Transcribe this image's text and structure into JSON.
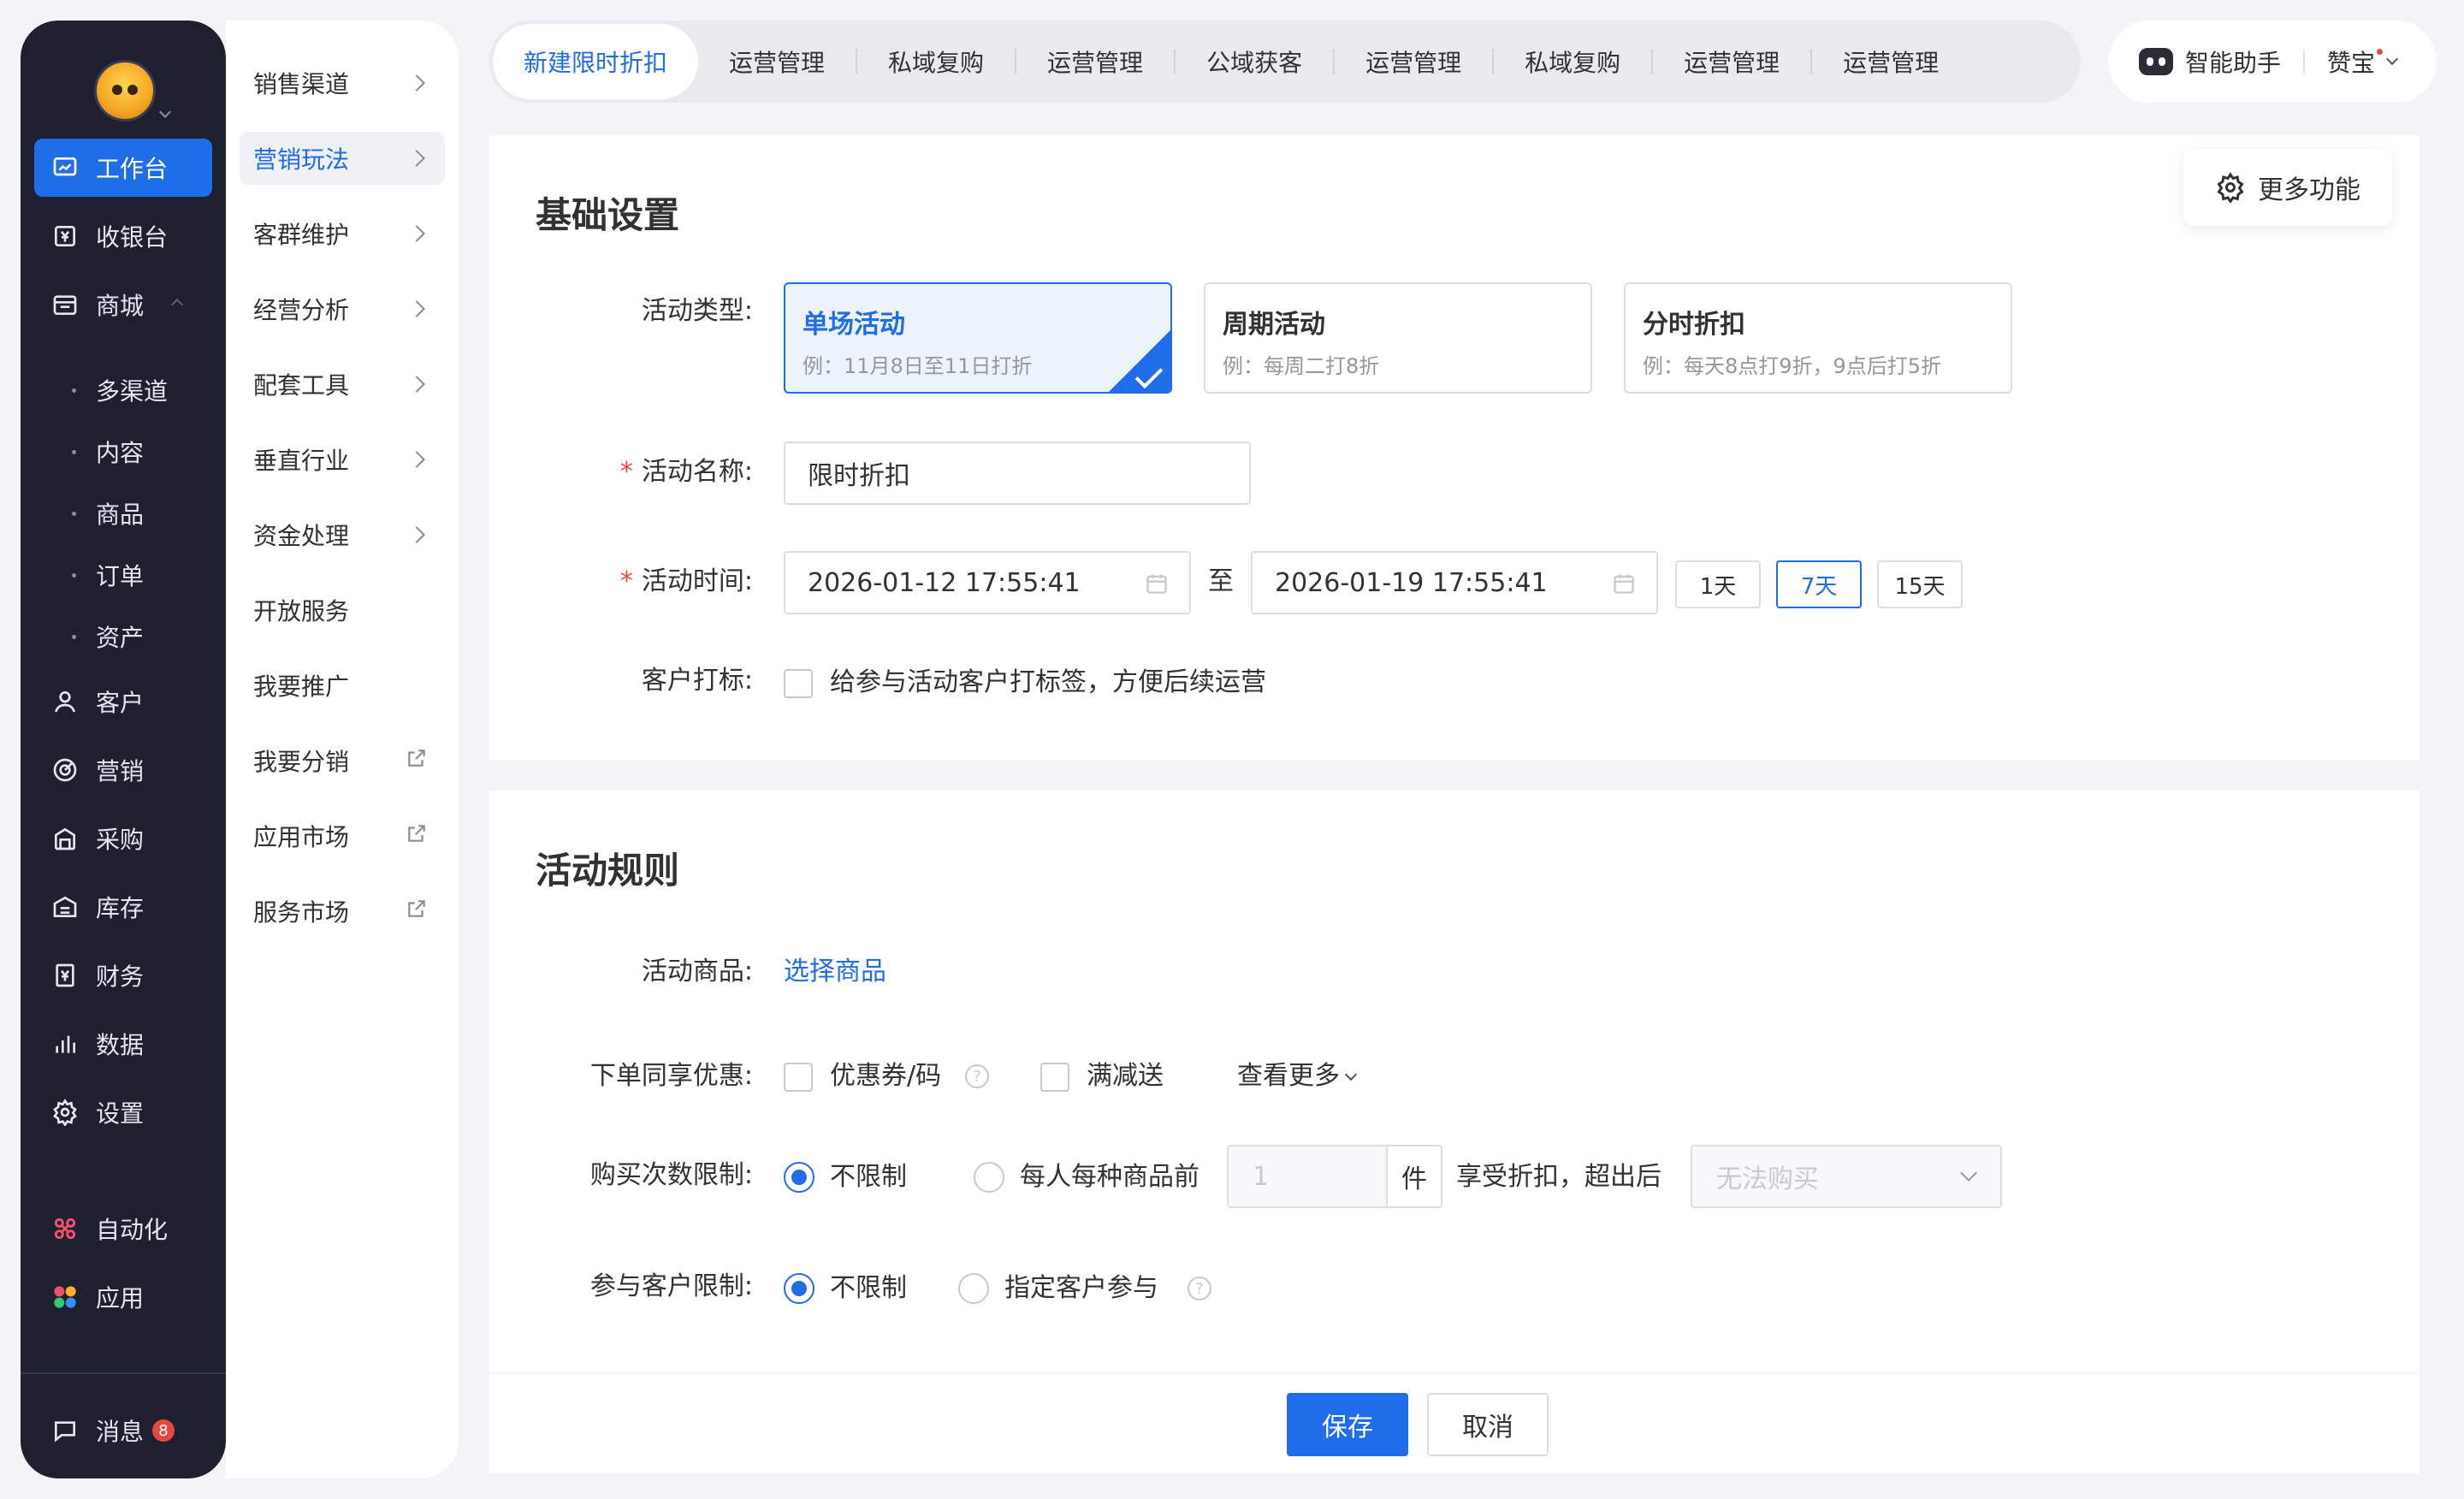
{
  "primary_nav": {
    "items": [
      {
        "label": "工作台",
        "icon": "workbench-icon",
        "active": true
      },
      {
        "label": "收银台",
        "icon": "cashier-icon"
      },
      {
        "label": "商城",
        "icon": "store-icon"
      },
      {
        "label": "客户",
        "icon": "user-icon"
      },
      {
        "label": "营销",
        "icon": "target-icon"
      },
      {
        "label": "采购",
        "icon": "purchase-icon"
      },
      {
        "label": "库存",
        "icon": "warehouse-icon"
      },
      {
        "label": "财务",
        "icon": "finance-icon"
      },
      {
        "label": "数据",
        "icon": "bar-chart-icon"
      },
      {
        "label": "设置",
        "icon": "gear-icon"
      },
      {
        "label": "自动化",
        "icon": "automation-icon"
      },
      {
        "label": "应用",
        "icon": "apps-icon"
      }
    ],
    "store_sub": [
      "多渠道",
      "内容",
      "商品",
      "订单",
      "资产"
    ],
    "messages": {
      "label": "消息",
      "badge": "8"
    }
  },
  "secondary_nav": {
    "items": [
      {
        "label": "销售渠道",
        "trail": "chevron"
      },
      {
        "label": "营销玩法",
        "trail": "chevron",
        "active": true
      },
      {
        "label": "客群维护",
        "trail": "chevron"
      },
      {
        "label": "经营分析",
        "trail": "chevron"
      },
      {
        "label": "配套工具",
        "trail": "chevron"
      },
      {
        "label": "垂直行业",
        "trail": "chevron"
      },
      {
        "label": "资金处理",
        "trail": "chevron"
      },
      {
        "label": "开放服务",
        "trail": ""
      },
      {
        "label": "我要推广",
        "trail": ""
      },
      {
        "label": "我要分销",
        "trail": "external"
      },
      {
        "label": "应用市场",
        "trail": "external"
      },
      {
        "label": "服务市场",
        "trail": "external"
      }
    ]
  },
  "tabs": [
    "新建限时折扣",
    "运营管理",
    "私域复购",
    "运营管理",
    "公域获客",
    "运营管理",
    "私域复购",
    "运营管理",
    "运营管理"
  ],
  "assistant": {
    "label": "智能助手",
    "user": "赞宝"
  },
  "more_functions": "更多功能",
  "basic": {
    "title": "基础设置",
    "type_label": "活动类型:",
    "types": [
      {
        "title": "单场活动",
        "desc": "例：11月8日至11日打折",
        "selected": true
      },
      {
        "title": "周期活动",
        "desc": "例：每周二打8折"
      },
      {
        "title": "分时折扣",
        "desc": "例：每天8点打9折，9点后打5折"
      }
    ],
    "name_label": "活动名称:",
    "name_value": "限时折扣",
    "time_label": "活动时间:",
    "start": "2026-01-12 17:55:41",
    "to": "至",
    "end": "2026-01-19 17:55:41",
    "quick": [
      "1天",
      "7天",
      "15天"
    ],
    "quick_active": "7天",
    "tag_label": "客户打标:",
    "tag_text": "给参与活动客户打标签，方便后续运营"
  },
  "rules": {
    "title": "活动规则",
    "goods_label": "活动商品:",
    "goods_link": "选择商品",
    "share_label": "下单同享优惠:",
    "coupon": "优惠券/码",
    "full_reduce": "满减送",
    "see_more": "查看更多",
    "limit_label": "购买次数限制:",
    "unlimited": "不限制",
    "per_person": "每人每种商品前",
    "qty_value": "1",
    "unit": "件",
    "after_text": "享受折扣，超出后",
    "after_select": "无法购买",
    "customer_label": "参与客户限制:",
    "customer_unlimited": "不限制",
    "specified": "指定客户参与"
  },
  "footer": {
    "save": "保存",
    "cancel": "取消"
  },
  "colors": {
    "primary": "#1f6de8",
    "sidebar": "#1e2030",
    "danger": "#e5483f"
  }
}
